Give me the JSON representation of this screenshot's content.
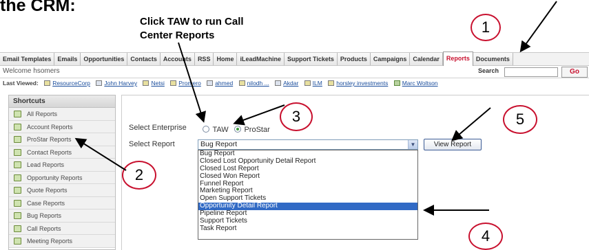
{
  "heading": "the CRM:",
  "instruction": "Click TAW to run Call Center Reports",
  "tabs": [
    {
      "label": "Email Templates"
    },
    {
      "label": "Emails"
    },
    {
      "label": "Opportunities"
    },
    {
      "label": "Contacts"
    },
    {
      "label": "Accounts"
    },
    {
      "label": "RSS"
    },
    {
      "label": "Home"
    },
    {
      "label": "iLeadMachine"
    },
    {
      "label": "Support Tickets"
    },
    {
      "label": "Products"
    },
    {
      "label": "Campaigns"
    },
    {
      "label": "Calendar"
    },
    {
      "label": "Reports",
      "active": true
    },
    {
      "label": "Documents"
    }
  ],
  "welcome": "Welcome hsomers",
  "search": {
    "label": "Search",
    "value": "",
    "go": "Go"
  },
  "last_viewed": {
    "label": "Last Viewed:",
    "items": [
      {
        "label": "ResourceCorp",
        "icon": "folder-icon"
      },
      {
        "label": "John Harvey",
        "icon": "document-icon"
      },
      {
        "label": "Netsi",
        "icon": "folder-icon"
      },
      {
        "label": "Promero",
        "icon": "folder-icon"
      },
      {
        "label": "ahmed",
        "icon": "document-icon"
      },
      {
        "label": "nilodh ...",
        "icon": "folder-icon"
      },
      {
        "label": "Akdar",
        "icon": "document-icon"
      },
      {
        "label": "ILM",
        "icon": "folder-icon"
      },
      {
        "label": "horsley investments",
        "icon": "folder-icon"
      },
      {
        "label": "Marc Woltson",
        "icon": "user-icon"
      }
    ]
  },
  "sidebar": {
    "title": "Shortcuts",
    "items": [
      {
        "label": "All Reports"
      },
      {
        "label": "Account Reports"
      },
      {
        "label": "ProStar Reports"
      },
      {
        "label": "Contact Reports"
      },
      {
        "label": "Lead Reports"
      },
      {
        "label": "Opportunity Reports"
      },
      {
        "label": "Quote Reports"
      },
      {
        "label": "Case Reports"
      },
      {
        "label": "Bug Reports"
      },
      {
        "label": "Call Reports"
      },
      {
        "label": "Meeting Reports"
      }
    ]
  },
  "form": {
    "enterprise_label": "Select Enterprise",
    "enterprise_options": [
      {
        "label": "TAW",
        "checked": false
      },
      {
        "label": "ProStar",
        "checked": true
      }
    ],
    "report_label": "Select Report",
    "report_selected": "Bug Report",
    "report_options": [
      "Bug Report",
      "Closed Lost Opportunity Detail Report",
      "Closed Lost Report",
      "Closed Won Report",
      "Funnel Report",
      "Marketing Report",
      "Open Support Tickets",
      "Opportunity Detail Report",
      "Pipeline Report",
      "Support Tickets",
      "Task Report"
    ],
    "highlighted_option": "Opportunity Detail Report",
    "view_button": "View Report"
  },
  "steps": [
    "1",
    "2",
    "3",
    "4",
    "5"
  ],
  "colors": {
    "accent": "#c8102e",
    "selection": "#316ac5",
    "link": "#1a4d9c"
  }
}
